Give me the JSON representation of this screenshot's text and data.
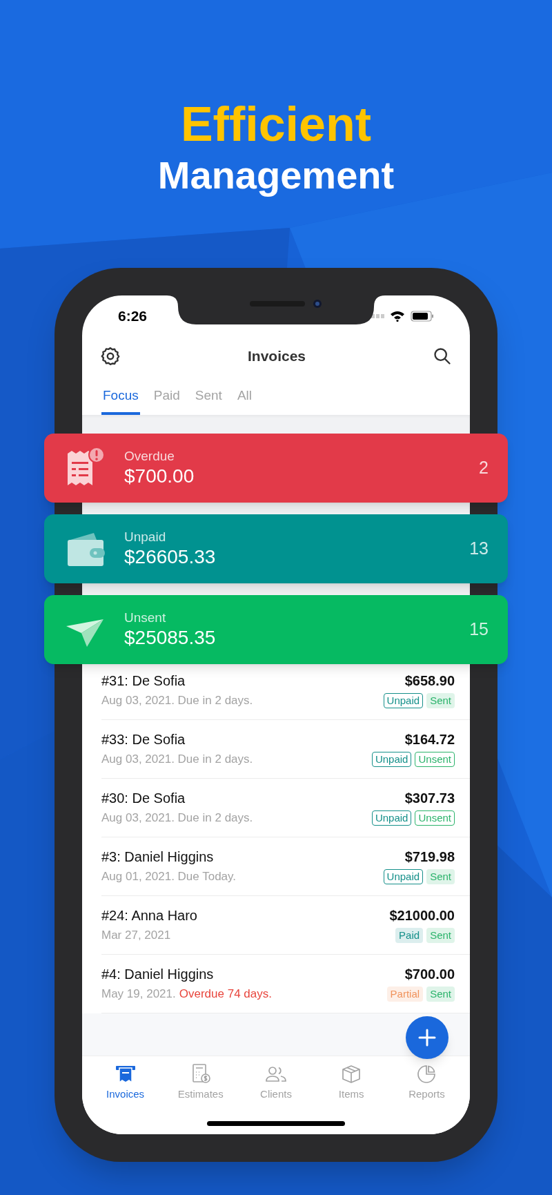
{
  "headline": {
    "line_1": "Efficient",
    "line_2": "Management"
  },
  "status_bar": {
    "time": "6:26"
  },
  "header": {
    "title": "Invoices"
  },
  "tabs": [
    {
      "label": "Focus",
      "selected": true
    },
    {
      "label": "Paid",
      "selected": false
    },
    {
      "label": "Sent",
      "selected": false
    },
    {
      "label": "All",
      "selected": false
    }
  ],
  "summary_cards": [
    {
      "kind": "overdue",
      "color": "#e23a49",
      "label": "Overdue",
      "amount": "$700.00",
      "count": "2"
    },
    {
      "kind": "unpaid",
      "color": "#019290",
      "label": "Unpaid",
      "amount": "$26605.33",
      "count": "13"
    },
    {
      "kind": "unsent",
      "color": "#06ba62",
      "label": "Unsent",
      "amount": "$25085.35",
      "count": "15"
    }
  ],
  "invoices": [
    {
      "title": "#31: De Sofia",
      "amount": "$658.90",
      "subtitle": "Aug 03, 2021. Due in 2 days.",
      "tags": [
        {
          "label": "Unpaid",
          "kind": "outline",
          "color": "#15908a"
        },
        {
          "label": "Sent",
          "kind": "filled",
          "color": "#2bb36b"
        }
      ]
    },
    {
      "title": "#33: De Sofia",
      "amount": "$164.72",
      "subtitle": "Aug 03, 2021. Due in 2 days.",
      "tags": [
        {
          "label": "Unpaid",
          "kind": "outline",
          "color": "#15908a"
        },
        {
          "label": "Unsent",
          "kind": "outline",
          "color": "#2bb36b"
        }
      ]
    },
    {
      "title": "#30: De Sofia",
      "amount": "$307.73",
      "subtitle": "Aug 03, 2021. Due in 2 days.",
      "tags": [
        {
          "label": "Unpaid",
          "kind": "outline",
          "color": "#15908a"
        },
        {
          "label": "Unsent",
          "kind": "outline",
          "color": "#2bb36b"
        }
      ]
    },
    {
      "title": "#3: Daniel Higgins",
      "amount": "$719.98",
      "subtitle": "Aug 01, 2021. Due Today.",
      "tags": [
        {
          "label": "Unpaid",
          "kind": "outline",
          "color": "#15908a"
        },
        {
          "label": "Sent",
          "kind": "filled",
          "color": "#2bb36b"
        }
      ]
    },
    {
      "title": "#24: Anna Haro",
      "amount": "$21000.00",
      "subtitle": "Mar 27, 2021",
      "tags": [
        {
          "label": "Paid",
          "kind": "filled",
          "color": "#15908a"
        },
        {
          "label": "Sent",
          "kind": "filled",
          "color": "#2bb36b"
        }
      ]
    },
    {
      "title": "#4: Daniel Higgins",
      "amount": "$700.00",
      "subtitle": "May 19, 2021.",
      "alert": "Overdue 74 days.",
      "tags": [
        {
          "label": "Partial",
          "kind": "filled",
          "color": "#f0935c"
        },
        {
          "label": "Sent",
          "kind": "filled",
          "color": "#2bb36b"
        }
      ]
    }
  ],
  "bottom_nav": [
    {
      "kind": "invoices",
      "label": "Invoices",
      "selected": true
    },
    {
      "kind": "estimates",
      "label": "Estimates",
      "selected": false
    },
    {
      "kind": "clients",
      "label": "Clients",
      "selected": false
    },
    {
      "kind": "items",
      "label": "Items",
      "selected": false
    },
    {
      "kind": "reports",
      "label": "Reports",
      "selected": false
    }
  ]
}
